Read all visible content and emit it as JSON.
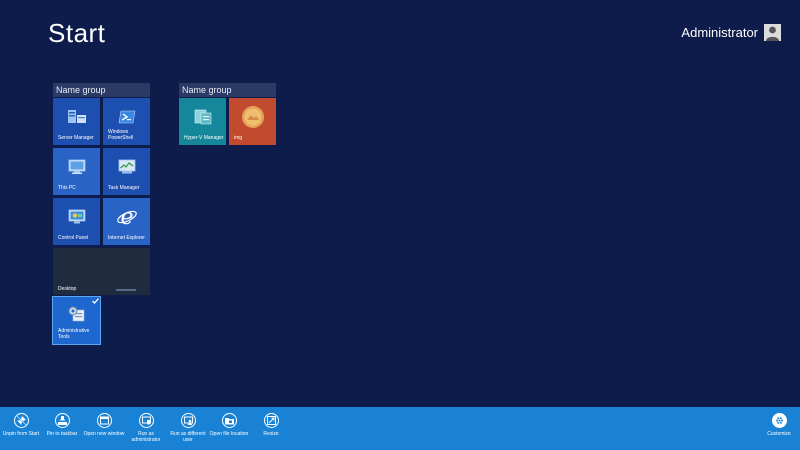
{
  "header": {
    "title": "Start",
    "username": "Administrator"
  },
  "groups": [
    {
      "name": "Name group",
      "tiles": [
        {
          "label": "Server Manager",
          "icon": "server-manager-icon",
          "color": "#1d4fb0"
        },
        {
          "label": "Windows PowerShell",
          "icon": "powershell-icon",
          "color": "#1d4fb0"
        },
        {
          "label": "This PC",
          "icon": "this-pc-icon",
          "color": "#2a63c6"
        },
        {
          "label": "Task Manager",
          "icon": "task-manager-icon",
          "color": "#1d4fb0"
        },
        {
          "label": "Control Panel",
          "icon": "control-panel-icon",
          "color": "#1d4fb0"
        },
        {
          "label": "Internet Explorer",
          "icon": "internet-explorer-icon",
          "color": "#2a63c6"
        },
        {
          "label": "Desktop",
          "icon": "desktop-wallpaper",
          "color": "#1f2b3e"
        },
        {
          "label": "Administrative Tools",
          "icon": "administrative-tools-icon",
          "color": "#1d67cf",
          "selected": true
        }
      ]
    },
    {
      "name": "Name group",
      "tiles": [
        {
          "label": "Hyper-V Manager",
          "icon": "hyper-v-icon",
          "color": "#14889a"
        },
        {
          "label": "img",
          "icon": "image-thumbnail",
          "color": "#c24a2e"
        }
      ]
    }
  ],
  "appbar": {
    "commands": [
      {
        "label": "Unpin from Start",
        "icon": "unpin-icon"
      },
      {
        "label": "Pin to taskbar",
        "icon": "pin-taskbar-icon"
      },
      {
        "label": "Open new window",
        "icon": "new-window-icon"
      },
      {
        "label": "Run as administrator",
        "icon": "run-as-admin-icon"
      },
      {
        "label": "Run as different user",
        "icon": "run-as-user-icon"
      },
      {
        "label": "Open file location",
        "icon": "file-location-icon"
      },
      {
        "label": "Resize",
        "icon": "resize-icon"
      }
    ],
    "customize": {
      "label": "Customize",
      "icon": "customize-icon"
    }
  },
  "colors": {
    "background": "#0d1c4a",
    "appbar": "#1a82d4",
    "group_header": "#2a3a64"
  }
}
